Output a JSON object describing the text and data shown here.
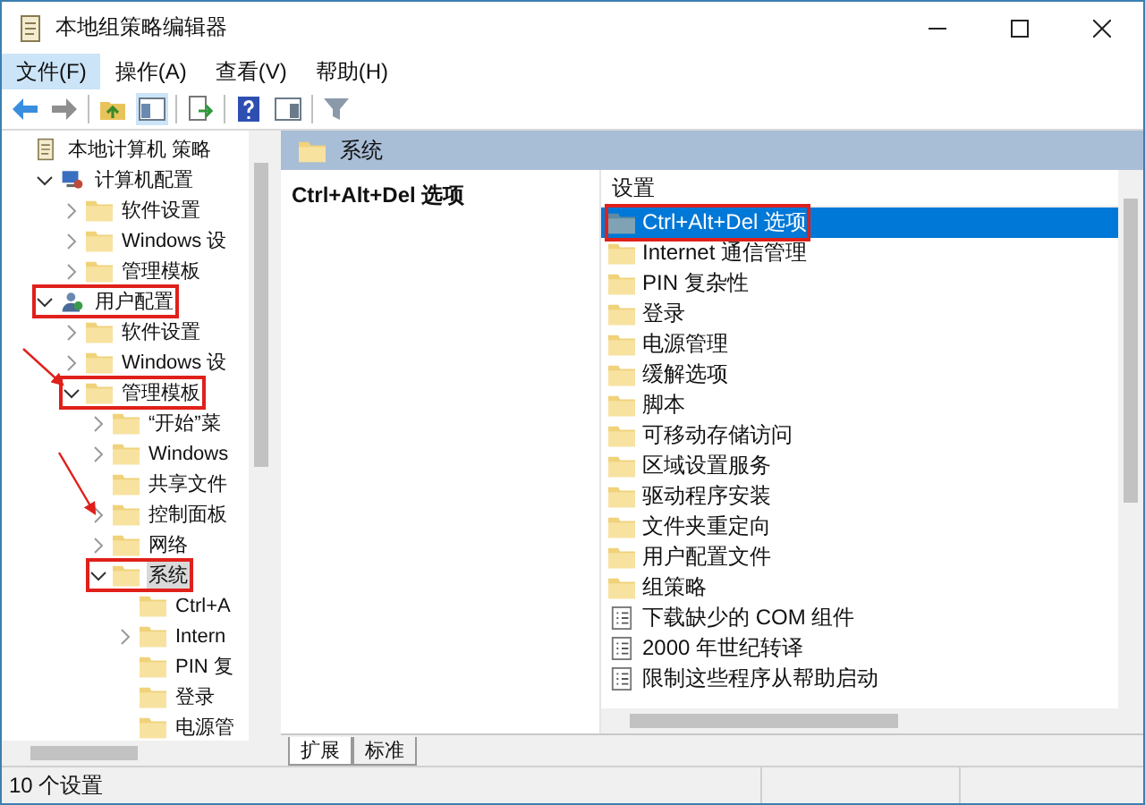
{
  "window": {
    "title": "本地组策略编辑器"
  },
  "menu": [
    {
      "label": "文件(F)",
      "selected": true
    },
    {
      "label": "操作(A)",
      "selected": false
    },
    {
      "label": "查看(V)",
      "selected": false
    },
    {
      "label": "帮助(H)",
      "selected": false
    }
  ],
  "tree": [
    {
      "label": "本地计算机 策略",
      "kind": "policy",
      "selected": false,
      "outlined": false,
      "children": [
        {
          "label": "计算机配置",
          "kind": "computer",
          "expanded": true,
          "selected": false,
          "outlined": false,
          "children": [
            {
              "label": "软件设置",
              "kind": "folder",
              "expanded": false,
              "selected": false,
              "outlined": false
            },
            {
              "label": "Windows 设",
              "kind": "folder",
              "expanded": false,
              "selected": false,
              "outlined": false
            },
            {
              "label": "管理模板",
              "kind": "folder",
              "expanded": false,
              "selected": false,
              "outlined": false
            }
          ]
        },
        {
          "label": "用户配置",
          "kind": "user",
          "expanded": true,
          "selected": false,
          "outlined": true,
          "children": [
            {
              "label": "软件设置",
              "kind": "folder",
              "expanded": false,
              "selected": false,
              "outlined": false
            },
            {
              "label": "Windows 设",
              "kind": "folder",
              "expanded": false,
              "selected": false,
              "outlined": false
            },
            {
              "label": "管理模板",
              "kind": "folder",
              "expanded": true,
              "selected": false,
              "outlined": true,
              "children": [
                {
                  "label": "“开始”菜",
                  "kind": "folder",
                  "expanded": false,
                  "selected": false,
                  "outlined": false
                },
                {
                  "label": "Windows",
                  "kind": "folder",
                  "expanded": false,
                  "selected": false,
                  "outlined": false
                },
                {
                  "label": "共享文件",
                  "kind": "folder",
                  "selected": false,
                  "outlined": false
                },
                {
                  "label": "控制面板",
                  "kind": "folder",
                  "expanded": false,
                  "selected": false,
                  "outlined": false
                },
                {
                  "label": "网络",
                  "kind": "folder",
                  "expanded": false,
                  "selected": false,
                  "outlined": false
                },
                {
                  "label": "系统",
                  "kind": "folder",
                  "expanded": true,
                  "selected": true,
                  "outlined": true,
                  "children": [
                    {
                      "label": "Ctrl+A",
                      "kind": "folder",
                      "selected": false,
                      "outlined": false
                    },
                    {
                      "label": "Intern",
                      "kind": "folder",
                      "expanded": false,
                      "selected": false,
                      "outlined": false
                    },
                    {
                      "label": "PIN 复",
                      "kind": "folder",
                      "selected": false,
                      "outlined": false
                    },
                    {
                      "label": "登录",
                      "kind": "folder",
                      "selected": false,
                      "outlined": false
                    },
                    {
                      "label": "电源管",
                      "kind": "folder",
                      "selected": false,
                      "outlined": false
                    }
                  ]
                }
              ]
            }
          ]
        }
      ]
    }
  ],
  "header": "系统",
  "description": "Ctrl+Alt+Del 选项",
  "list_column": "设置",
  "settings": [
    {
      "label": "Ctrl+Alt+Del 选项",
      "kind": "folder",
      "selected": true,
      "outlined": true
    },
    {
      "label": "Internet 通信管理",
      "kind": "folder",
      "selected": false,
      "outlined": false
    },
    {
      "label": "PIN 复杂性",
      "kind": "folder",
      "selected": false,
      "outlined": false
    },
    {
      "label": "登录",
      "kind": "folder",
      "selected": false,
      "outlined": false
    },
    {
      "label": "电源管理",
      "kind": "folder",
      "selected": false,
      "outlined": false
    },
    {
      "label": "缓解选项",
      "kind": "folder",
      "selected": false,
      "outlined": false
    },
    {
      "label": "脚本",
      "kind": "folder",
      "selected": false,
      "outlined": false
    },
    {
      "label": "可移动存储访问",
      "kind": "folder",
      "selected": false,
      "outlined": false
    },
    {
      "label": "区域设置服务",
      "kind": "folder",
      "selected": false,
      "outlined": false
    },
    {
      "label": "驱动程序安装",
      "kind": "folder",
      "selected": false,
      "outlined": false
    },
    {
      "label": "文件夹重定向",
      "kind": "folder",
      "selected": false,
      "outlined": false
    },
    {
      "label": "用户配置文件",
      "kind": "folder",
      "selected": false,
      "outlined": false
    },
    {
      "label": "组策略",
      "kind": "folder",
      "selected": false,
      "outlined": false
    },
    {
      "label": "下载缺少的 COM 组件",
      "kind": "setting",
      "selected": false,
      "outlined": false
    },
    {
      "label": "2000 年世纪转译",
      "kind": "setting",
      "selected": false,
      "outlined": false
    },
    {
      "label": "限制这些程序从帮助启动",
      "kind": "setting",
      "selected": false,
      "outlined": false
    }
  ],
  "tabs": [
    {
      "label": "扩展",
      "selected": true
    },
    {
      "label": "标准",
      "selected": false
    }
  ],
  "status_bar": "10 个设置"
}
